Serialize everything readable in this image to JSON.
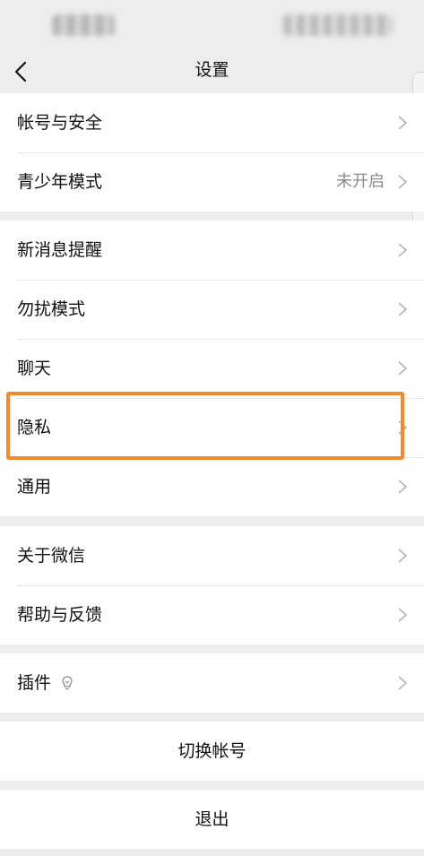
{
  "nav": {
    "title": "设置",
    "back_icon": "chevron-left-icon"
  },
  "groups": [
    {
      "items": [
        {
          "label": "帐号与安全"
        },
        {
          "label": "青少年模式",
          "value": "未开启"
        }
      ]
    },
    {
      "items": [
        {
          "label": "新消息提醒"
        },
        {
          "label": "勿扰模式"
        },
        {
          "label": "聊天"
        },
        {
          "label": "隐私"
        },
        {
          "label": "通用"
        }
      ]
    },
    {
      "items": [
        {
          "label": "关于微信"
        },
        {
          "label": "帮助与反馈"
        }
      ]
    },
    {
      "items": [
        {
          "label": "插件",
          "icon": "lightbulb-icon"
        }
      ]
    }
  ],
  "actions": {
    "switch_account": "切换帐号",
    "logout": "退出"
  },
  "highlight_color": "#f28a2c"
}
